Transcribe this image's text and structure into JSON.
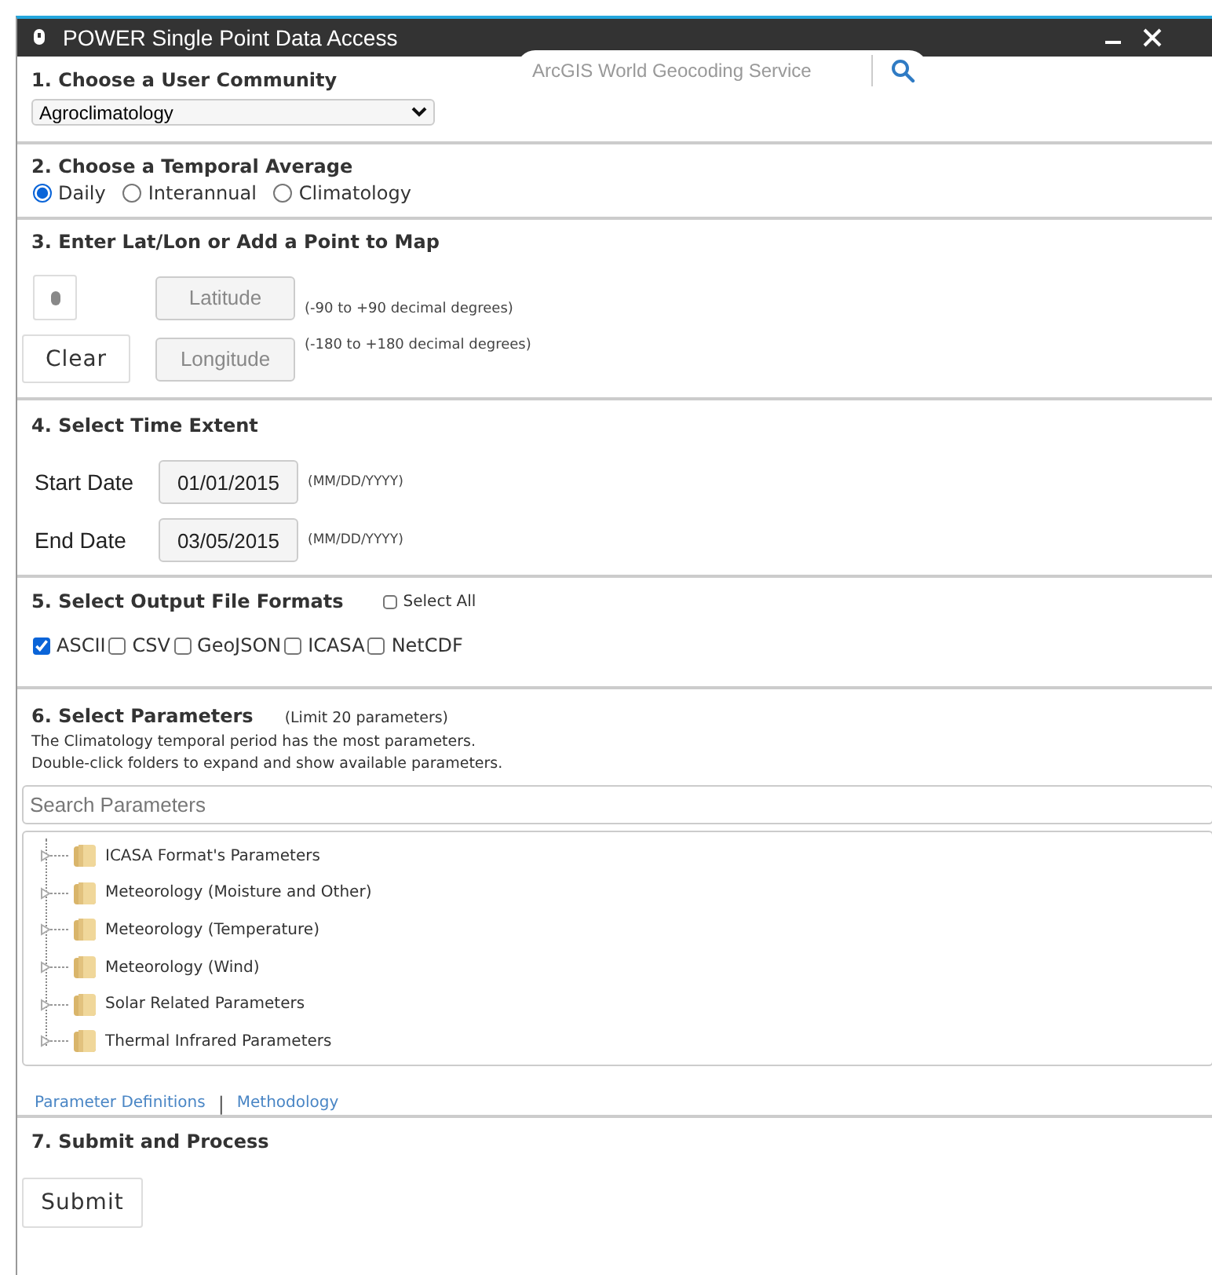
{
  "window": {
    "title": "POWER Single Point Data Access"
  },
  "geocoder": {
    "placeholder": "ArcGIS World Geocoding Service"
  },
  "community": {
    "heading": "1. Choose a User Community",
    "value": "Agroclimatology"
  },
  "temporal": {
    "heading": "2. Choose a Temporal Average",
    "options": [
      {
        "label": "Daily",
        "selected": true
      },
      {
        "label": "Interannual",
        "selected": false
      },
      {
        "label": "Climatology",
        "selected": false
      }
    ]
  },
  "location": {
    "heading": "3. Enter Lat/Lon or Add a Point to Map",
    "clear_button": "Clear",
    "latitude": {
      "placeholder": "Latitude",
      "hint": "(-90 to +90 decimal degrees)"
    },
    "longitude": {
      "placeholder": "Longitude",
      "hint": "(-180 to +180 decimal degrees)"
    }
  },
  "time_extent": {
    "heading": "4. Select Time Extent",
    "start": {
      "label": "Start Date",
      "value": "01/01/2015",
      "hint": "(MM/DD/YYYY)"
    },
    "end": {
      "label": "End Date",
      "value": "03/05/2015",
      "hint": "(MM/DD/YYYY)"
    }
  },
  "formats": {
    "heading": "5. Select Output File Formats",
    "select_all": {
      "label": "Select All",
      "checked": false
    },
    "options": [
      {
        "label": "ASCII",
        "checked": true
      },
      {
        "label": "CSV",
        "checked": false
      },
      {
        "label": "GeoJSON",
        "checked": false
      },
      {
        "label": "ICASA",
        "checked": false
      },
      {
        "label": "NetCDF",
        "checked": false
      }
    ]
  },
  "parameters": {
    "heading": "6. Select Parameters",
    "limit": "(Limit 20 parameters)",
    "notes": [
      "The Climatology temporal period has the most parameters.",
      "Double-click folders to expand and show available parameters."
    ],
    "search": {
      "placeholder": "Search Parameters"
    },
    "tree": [
      {
        "label": "ICASA Format's Parameters"
      },
      {
        "label": "Meteorology (Moisture and Other)"
      },
      {
        "label": "Meteorology (Temperature)"
      },
      {
        "label": "Meteorology (Wind)"
      },
      {
        "label": "Solar Related Parameters"
      },
      {
        "label": "Thermal Infrared Parameters"
      }
    ],
    "links": [
      "Parameter Definitions",
      "Methodology"
    ],
    "separator": "|"
  },
  "submit": {
    "heading": "7. Submit and Process",
    "button": "Submit"
  }
}
